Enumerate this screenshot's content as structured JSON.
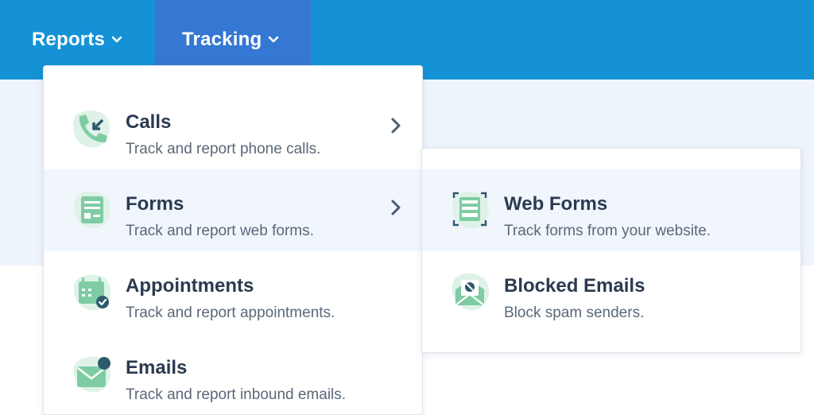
{
  "nav": {
    "reports_label": "Reports",
    "tracking_label": "Tracking"
  },
  "tracking_menu": {
    "items": [
      {
        "title": "Calls",
        "desc": "Track and report phone calls.",
        "icon": "phone-call-icon",
        "has_submenu": true
      },
      {
        "title": "Forms",
        "desc": "Track and report web forms.",
        "icon": "form-icon",
        "has_submenu": true
      },
      {
        "title": "Appointments",
        "desc": "Track and report appointments.",
        "icon": "calendar-icon",
        "has_submenu": false
      },
      {
        "title": "Emails",
        "desc": "Track and report inbound emails.",
        "icon": "email-icon",
        "has_submenu": false
      }
    ]
  },
  "forms_submenu": {
    "items": [
      {
        "title": "Web Forms",
        "desc": "Track forms from your website.",
        "icon": "web-form-icon"
      },
      {
        "title": "Blocked Emails",
        "desc": "Block spam senders.",
        "icon": "blocked-email-icon"
      }
    ]
  },
  "colors": {
    "topbar": "#1592d6",
    "active_nav": "#3578d3",
    "icon_green": "#7fcca4",
    "icon_bg": "#dff2e8",
    "icon_dark": "#2e5a6e"
  }
}
